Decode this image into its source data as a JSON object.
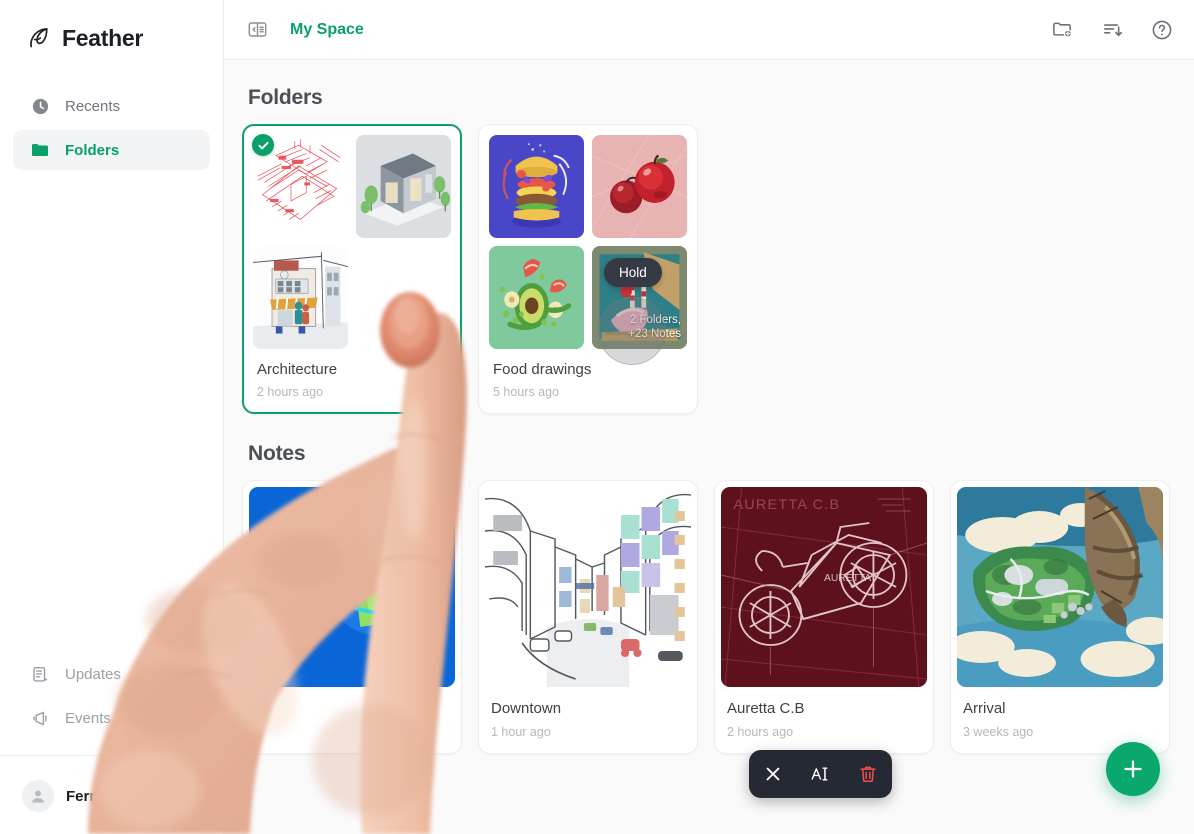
{
  "brand": {
    "name": "Feather",
    "logo_icon": "feather-icon"
  },
  "sidebar": {
    "items": [
      {
        "label": "Recents",
        "icon": "clock-icon",
        "active": false
      },
      {
        "label": "Folders",
        "icon": "folder-icon",
        "active": true
      }
    ],
    "bottom_items": [
      {
        "label": "Updates",
        "icon": "note-sparkle-icon"
      },
      {
        "label": "Events",
        "icon": "megaphone-icon"
      }
    ],
    "user": {
      "name": "Ferr",
      "avatar_icon": "person-icon"
    }
  },
  "topbar": {
    "collapse_icon": "sidebar-collapse-icon",
    "title": "My Space",
    "actions": [
      {
        "name": "new-folder",
        "icon": "folder-plus-icon"
      },
      {
        "name": "sort",
        "icon": "sort-descending-icon"
      },
      {
        "name": "help",
        "icon": "help-circle-icon"
      }
    ]
  },
  "sections": {
    "folders_title": "Folders",
    "notes_title": "Notes"
  },
  "folders": [
    {
      "name": "Architecture",
      "time": "2 hours ago",
      "selected": true,
      "thumbs": [
        "red-blueprint-sketch",
        "grey-isometric-house",
        "street-shop-illustration",
        "empty-white"
      ]
    },
    {
      "name": "Food drawings",
      "time": "5 hours ago",
      "selected": false,
      "thumbs": [
        "burger-on-blue",
        "apples-on-pink",
        "avocado-on-green",
        "ice-cream-painting"
      ],
      "overlay": {
        "line1": "2 Folders,",
        "line2": "+23 Notes"
      }
    }
  ],
  "notes": [
    {
      "name": "",
      "time": "",
      "thumb": "blue-abstract",
      "hidden_by_hand": true
    },
    {
      "name": "Downtown",
      "time": "1 hour ago",
      "thumb": "city-street-sketch"
    },
    {
      "name": "Auretta C.B",
      "time": "2 hours ago",
      "thumb": "dark-red-vehicle-blueprint",
      "caption": "AURETTA C.B"
    },
    {
      "name": "Arrival",
      "time": "3 weeks ago",
      "thumb": "airship-island-painting"
    }
  ],
  "gesture": {
    "tooltip": "Hold"
  },
  "action_bar": {
    "buttons": [
      {
        "name": "close",
        "icon": "close-icon",
        "color": "#ffffff"
      },
      {
        "name": "rename",
        "icon": "text-cursor-icon",
        "color": "#ffffff"
      },
      {
        "name": "delete",
        "icon": "trash-icon",
        "color": "#ef4d4d"
      }
    ]
  },
  "fab": {
    "icon": "plus-icon",
    "color": "#0aa86c"
  },
  "colors": {
    "accent_green": "#0aa06a",
    "fab_green": "#0aa86c",
    "background": "#fafafb",
    "text_primary": "#3c4248",
    "text_muted": "#b3b8bd",
    "action_bar_bg": "#242933",
    "danger_red": "#ef4d4d"
  }
}
